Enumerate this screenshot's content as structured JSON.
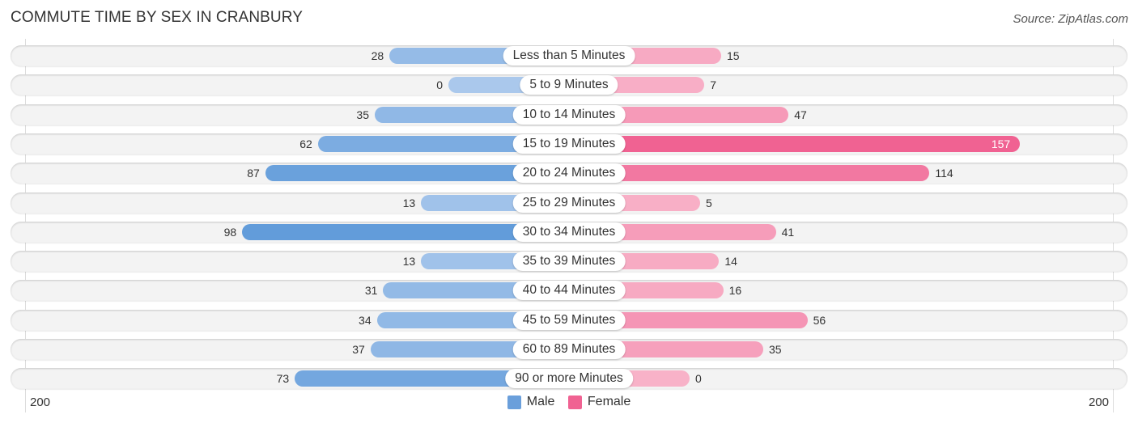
{
  "chart_data": {
    "type": "bar",
    "orientation": "horizontal-diverging",
    "title": "COMMUTE TIME BY SEX IN CRANBURY",
    "source": "Source: ZipAtlas.com",
    "categories": [
      "Less than 5 Minutes",
      "5 to 9 Minutes",
      "10 to 14 Minutes",
      "15 to 19 Minutes",
      "20 to 24 Minutes",
      "25 to 29 Minutes",
      "30 to 34 Minutes",
      "35 to 39 Minutes",
      "40 to 44 Minutes",
      "45 to 59 Minutes",
      "60 to 89 Minutes",
      "90 or more Minutes"
    ],
    "series": [
      {
        "name": "Male",
        "color": "#6a9fdb",
        "values": [
          28,
          0,
          35,
          62,
          87,
          13,
          98,
          13,
          31,
          34,
          37,
          73
        ]
      },
      {
        "name": "Female",
        "color": "#f06292",
        "values": [
          15,
          7,
          47,
          157,
          114,
          5,
          41,
          14,
          16,
          56,
          35,
          0
        ]
      }
    ],
    "axis": {
      "left_tick": "200",
      "right_tick": "200",
      "range": [
        -200,
        200
      ]
    },
    "legend": {
      "position": "bottom-center",
      "items": [
        "Male",
        "Female"
      ]
    },
    "grid": false
  }
}
